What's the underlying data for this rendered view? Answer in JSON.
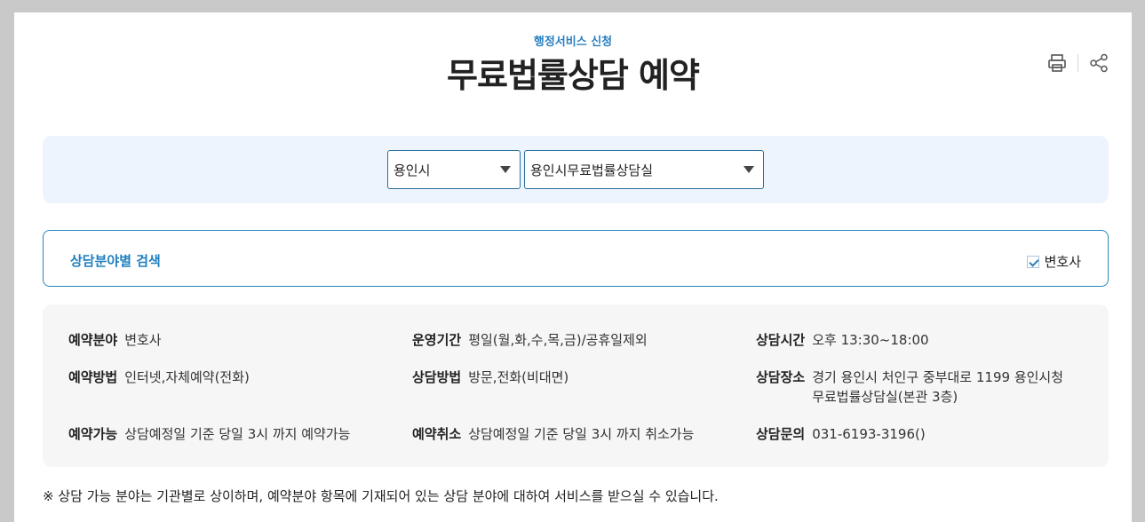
{
  "header": {
    "subtitle": "행정서비스 신청",
    "title": "무료법률상담 예약"
  },
  "tools": {
    "print_icon": "printer-icon",
    "share_icon": "share-icon"
  },
  "filters": {
    "region": "용인시",
    "office": "용인시무료법률상담실"
  },
  "search": {
    "title": "상담분야별 검색",
    "checkbox_label": "변호사",
    "checked": true
  },
  "info": {
    "field_label": "예약분야",
    "field_value": "변호사",
    "period_label": "운영기간",
    "period_value": "평일(월,화,수,목,금)/공휴일제외",
    "time_label": "상담시간",
    "time_value": "오후 13:30~18:00",
    "method_label": "예약방법",
    "method_value": "인터넷,자체예약(전화)",
    "consult_method_label": "상담방법",
    "consult_method_value": "방문,전화(비대면)",
    "place_label": "상담장소",
    "place_value_line1": "경기 용인시 처인구 중부대로 1199  용인시청",
    "place_value_line2": "무료법률상담실(본관 3층)",
    "avail_label": "예약가능",
    "avail_value": "상담예정일 기준 당일 3시 까지 예약가능",
    "cancel_label": "예약취소",
    "cancel_value": "상담예정일 기준 당일 3시 까지 취소가능",
    "contact_label": "상담문의",
    "contact_value": "031-6193-3196()"
  },
  "note": "※ 상담 가능 분야는 기관별로 상이하며, 예약분야 항목에 기재되어 있는 상담 분야에 대하여 서비스를 받으실 수 있습니다.",
  "colors": {
    "accent": "#1f7fbf",
    "filter_bg": "#eef4fd",
    "info_bg": "#f6f6f6"
  }
}
